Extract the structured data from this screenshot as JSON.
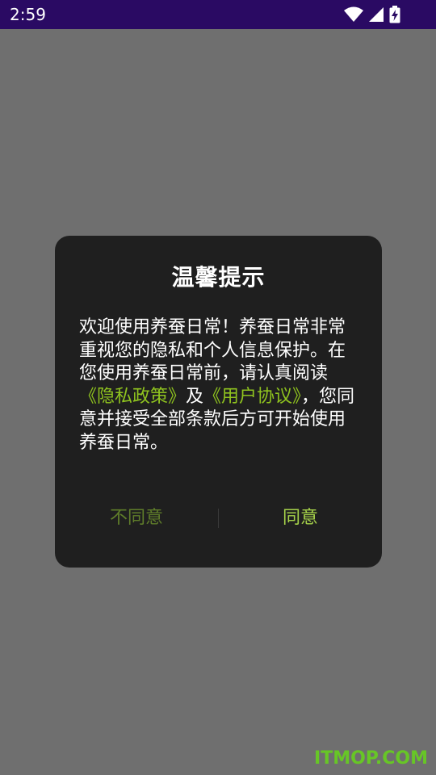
{
  "status_bar": {
    "time": "2:59",
    "icons": [
      "wifi-icon",
      "signal-icon",
      "battery-charging-icon"
    ],
    "background": "#2a0a63"
  },
  "dialog": {
    "title": "温馨提示",
    "message": {
      "part1": "欢迎使用养蚕日常！养蚕日常非常重视您的隐私和个人信息保护。在您使用养蚕日常前，请认真阅读",
      "privacy_link": "《隐私政策》",
      "part2": "及",
      "agreement_link": "《用户协议》",
      "part3": "，您同意并接受全部条款后方可开始使用养蚕日常。"
    },
    "disagree_label": "不同意",
    "agree_label": "同意",
    "accent_color": "#8fc31f"
  },
  "watermark": "ITMOP.COM"
}
